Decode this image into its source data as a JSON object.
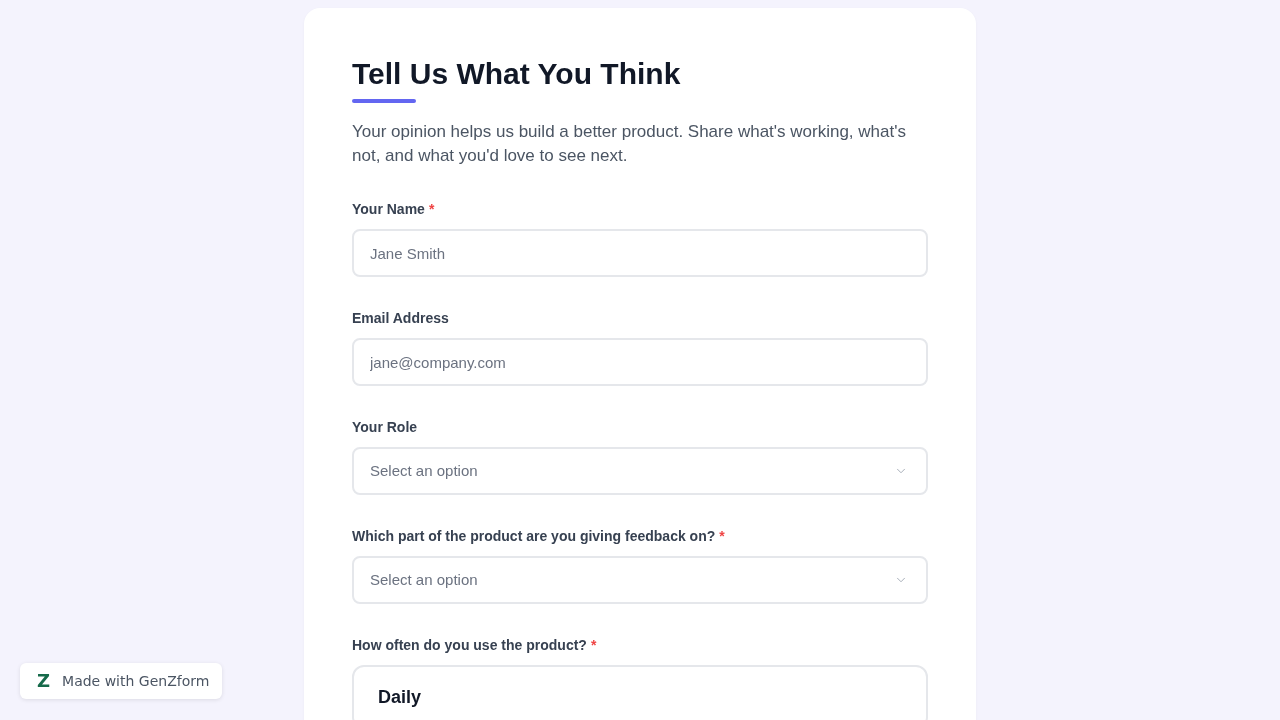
{
  "form": {
    "title": "Tell Us What You Think",
    "description": "Your opinion helps us build a better product. Share what's working, what's not, and what you'd love to see next.",
    "required_marker": "*",
    "fields": [
      {
        "kind": "text",
        "label": "Your Name",
        "required": true,
        "placeholder": "Jane Smith"
      },
      {
        "kind": "text",
        "label": "Email Address",
        "required": false,
        "placeholder": "jane@company.com"
      },
      {
        "kind": "select",
        "label": "Your Role",
        "required": false,
        "placeholder": "Select an option"
      },
      {
        "kind": "select",
        "label": "Which part of the product are you giving feedback on?",
        "required": true,
        "placeholder": "Select an option"
      },
      {
        "kind": "choice",
        "label": "How often do you use the product?",
        "required": true,
        "options": [
          {
            "label": "Daily",
            "selected": false
          }
        ]
      }
    ]
  },
  "badge": {
    "logo": "Z",
    "text": "Made with GenZform"
  }
}
